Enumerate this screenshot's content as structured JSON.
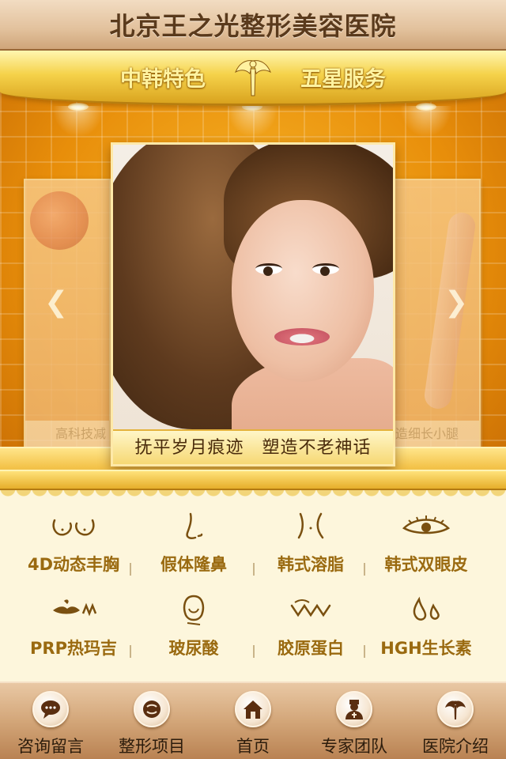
{
  "header": {
    "title": "北京王之光整形美容医院"
  },
  "banner": {
    "left_slogan": "中韩特色",
    "right_slogan": "五星服务",
    "logo_icon": "angel-logo-icon"
  },
  "carousel": {
    "prev_icon": "chevron-left-icon",
    "next_icon": "chevron-right-icon",
    "left_caption": "高科技减",
    "right_caption": "造细长小腿",
    "main_caption": "抚平岁月痕迹　塑造不老神话"
  },
  "services": [
    {
      "label": "4D动态丰胸",
      "icon": "breast-icon"
    },
    {
      "label": "假体隆鼻",
      "icon": "nose-icon"
    },
    {
      "label": "韩式溶脂",
      "icon": "waist-icon"
    },
    {
      "label": "韩式双眼皮",
      "icon": "eye-icon"
    },
    {
      "label": "PRP热玛吉",
      "icon": "lips-icon"
    },
    {
      "label": "玻尿酸",
      "icon": "face-icon"
    },
    {
      "label": "胶原蛋白",
      "icon": "wave-icon"
    },
    {
      "label": "HGH生长素",
      "icon": "drops-icon"
    }
  ],
  "nav": [
    {
      "label": "咨询留言",
      "icon": "chat-icon"
    },
    {
      "label": "整形项目",
      "icon": "projects-icon"
    },
    {
      "label": "首页",
      "icon": "home-icon"
    },
    {
      "label": "专家团队",
      "icon": "doctor-icon"
    },
    {
      "label": "医院介绍",
      "icon": "hospital-icon"
    }
  ],
  "colors": {
    "gold": "#e2a524",
    "brown": "#5a3a1c",
    "service_text": "#9a6a10"
  }
}
